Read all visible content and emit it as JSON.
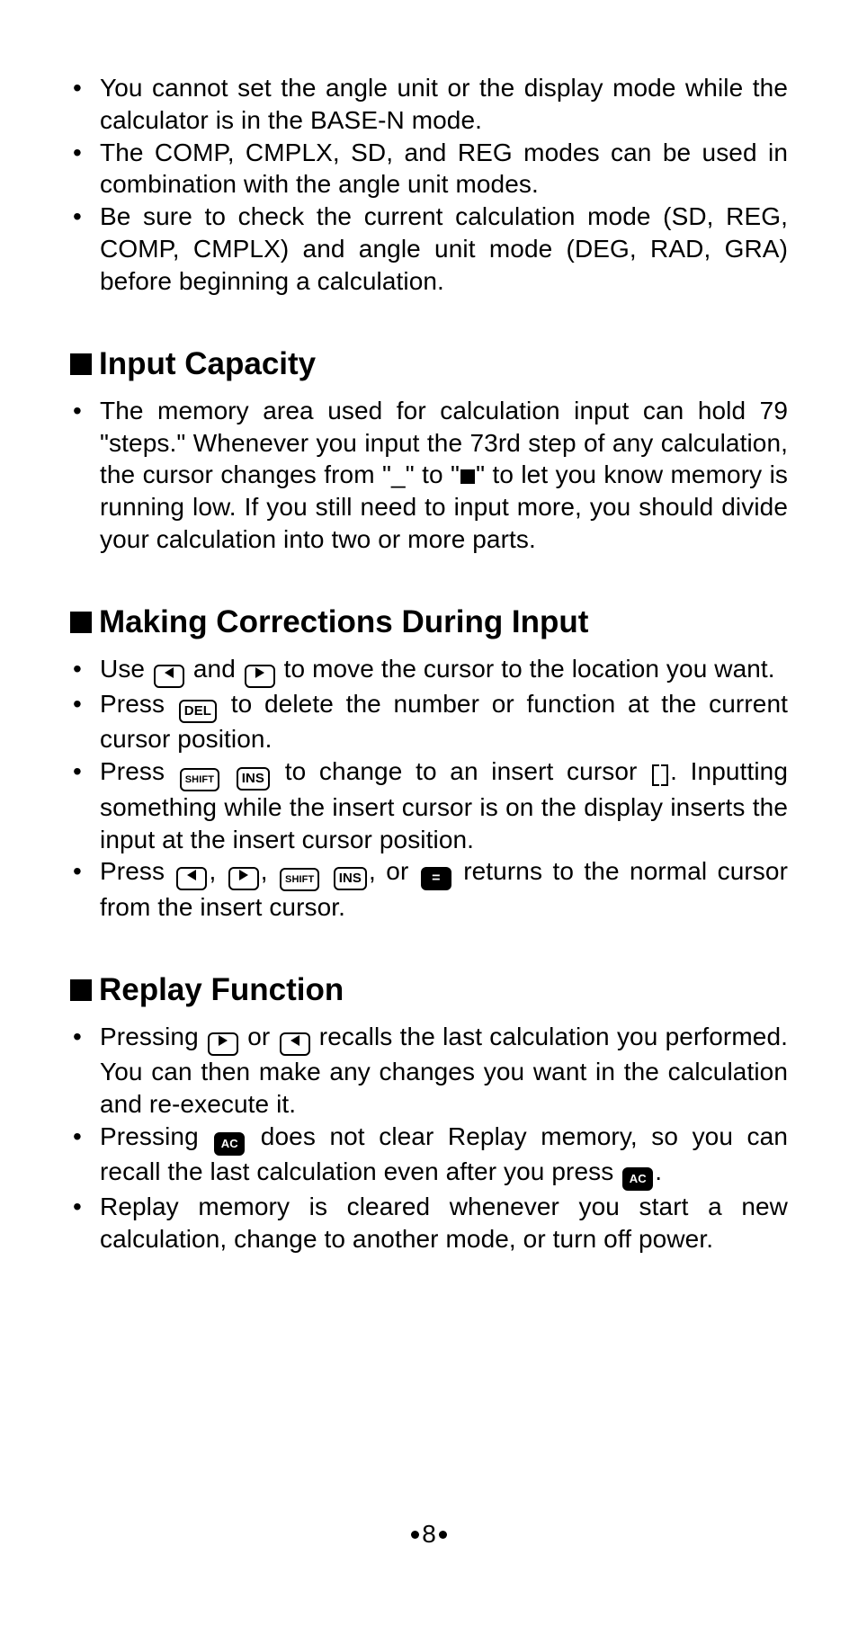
{
  "top_bullets": [
    "You cannot set the angle unit or the display mode while the calculator is in the BASE-N mode.",
    "The COMP, CMPLX, SD, and REG modes can be used in combination with the angle unit modes.",
    "Be sure to check the current calculation mode (SD, REG, COMP, CMPLX) and angle unit mode (DEG, RAD, GRA) before beginning a calculation."
  ],
  "sections": {
    "input_capacity": {
      "title": "Input Capacity",
      "bullets": {
        "b1a": "The memory area used for calculation input can hold 79 \"steps.\"  Whenever you input the 73rd step of any calculation, the cursor changes from \"_\" to \"",
        "b1b": "\" to let you know memory is running low. If you still need to input more, you should divide your calculation into two or more parts."
      }
    },
    "corrections": {
      "title": "Making Corrections During Input",
      "b1a": "Use ",
      "b1b": " and ",
      "b1c": " to move the cursor to the location you want.",
      "b2a": "Press ",
      "b2b": " to delete the number or function at the current cursor position.",
      "b3a": "Press ",
      "b3b": " to change to an insert cursor ",
      "b3c": ". Inputting something while the insert cursor is on the display inserts the input at the insert cursor position.",
      "b4a": "Press ",
      "b4b": ", ",
      "b4c": ", ",
      "b4d": ", or ",
      "b4e": " returns to the normal cursor from the insert cursor."
    },
    "replay": {
      "title": "Replay Function",
      "b1a": "Pressing ",
      "b1b": " or ",
      "b1c": " recalls the last calculation you performed. You can then make any changes you want in the calculation and re-execute it.",
      "b2a": "Pressing ",
      "b2b": " does not clear Replay memory, so you can recall the last calculation even after you press ",
      "b2c": ".",
      "b3": "Replay memory is cleared whenever you start a new calculation, change to another mode, or turn off power."
    }
  },
  "keys": {
    "left": "◀",
    "right": "▶",
    "del": "DEL",
    "shift": "SHIFT",
    "ins": "INS",
    "eq": "=",
    "ac": "AC"
  },
  "page_number": "8"
}
